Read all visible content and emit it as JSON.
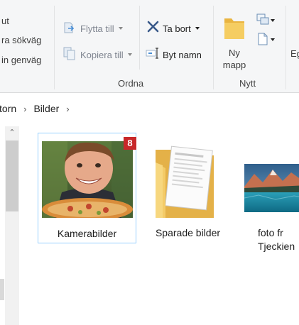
{
  "ribbon": {
    "left_items": [
      "ut",
      "ra sökväg",
      "in genväg"
    ],
    "move_to": "Flytta till",
    "copy_to": "Kopiera till",
    "delete": "Ta bort",
    "rename": "Byt namn",
    "organize_group": "Ordna",
    "new_folder_line1": "Ny",
    "new_folder_line2": "mapp",
    "new_group": "Nytt",
    "next_label": "Eg"
  },
  "address": {
    "crumbs": [
      "torn",
      "Bilder"
    ]
  },
  "items": [
    {
      "name": "Kamerabilder",
      "badge": "8"
    },
    {
      "name": "Sparade bilder"
    },
    {
      "name": "foto fr",
      "name2": "Tjeckien"
    }
  ],
  "colors": {
    "selection_border": "#99d1ff",
    "badge": "#c8282a",
    "folder": "#f2c55c"
  }
}
